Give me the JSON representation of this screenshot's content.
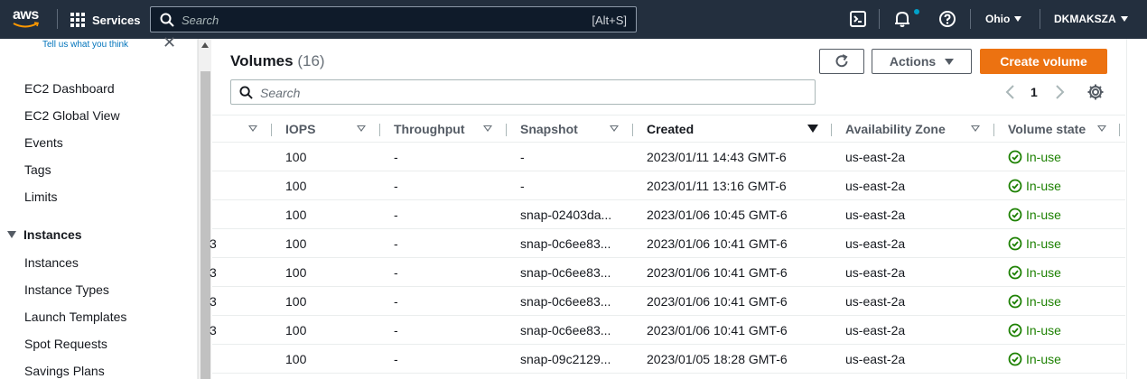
{
  "nav": {
    "logo_text": "aws",
    "services_label": "Services",
    "search_placeholder": "Search",
    "search_shortcut": "[Alt+S]",
    "region": "Ohio",
    "account": "DKMAKSZA"
  },
  "sidebar": {
    "feedback": "Tell us what you think",
    "items_top": [
      "EC2 Dashboard",
      "EC2 Global View",
      "Events",
      "Tags",
      "Limits"
    ],
    "section_instances": "Instances",
    "items_instances": [
      "Instances",
      "Instance Types",
      "Launch Templates",
      "Spot Requests",
      "Savings Plans"
    ]
  },
  "volumes": {
    "title": "Volumes",
    "count": "(16)",
    "actions_label": "Actions",
    "create_label": "Create volume",
    "filter_placeholder": "Search",
    "page": "1"
  },
  "table": {
    "headers": {
      "iops": "IOPS",
      "throughput": "Throughput",
      "snapshot": "Snapshot",
      "created": "Created",
      "az": "Availability Zone",
      "state": "Volume state"
    },
    "rows": [
      {
        "left": "",
        "iops": "100",
        "throughput": "-",
        "snapshot": "-",
        "created": "2023/01/11 14:43 GMT-6",
        "az": "us-east-2a",
        "state": "In-use"
      },
      {
        "left": "",
        "iops": "100",
        "throughput": "-",
        "snapshot": "-",
        "created": "2023/01/11 13:16 GMT-6",
        "az": "us-east-2a",
        "state": "In-use"
      },
      {
        "left": "",
        "iops": "100",
        "throughput": "-",
        "snapshot": "snap-02403da...",
        "created": "2023/01/06 10:45 GMT-6",
        "az": "us-east-2a",
        "state": "In-use"
      },
      {
        "left": "3",
        "iops": "100",
        "throughput": "-",
        "snapshot": "snap-0c6ee83...",
        "created": "2023/01/06 10:41 GMT-6",
        "az": "us-east-2a",
        "state": "In-use"
      },
      {
        "left": "3",
        "iops": "100",
        "throughput": "-",
        "snapshot": "snap-0c6ee83...",
        "created": "2023/01/06 10:41 GMT-6",
        "az": "us-east-2a",
        "state": "In-use"
      },
      {
        "left": "3",
        "iops": "100",
        "throughput": "-",
        "snapshot": "snap-0c6ee83...",
        "created": "2023/01/06 10:41 GMT-6",
        "az": "us-east-2a",
        "state": "In-use"
      },
      {
        "left": "3",
        "iops": "100",
        "throughput": "-",
        "snapshot": "snap-0c6ee83...",
        "created": "2023/01/06 10:41 GMT-6",
        "az": "us-east-2a",
        "state": "In-use"
      },
      {
        "left": "",
        "iops": "100",
        "throughput": "-",
        "snapshot": "snap-09c2129...",
        "created": "2023/01/05 18:28 GMT-6",
        "az": "us-east-2a",
        "state": "In-use"
      }
    ]
  },
  "colors": {
    "nav_bg": "#232f3e",
    "accent_orange": "#ec7211",
    "status_green": "#1d8102",
    "link_blue": "#0073bb"
  },
  "icons": [
    "aws-logo",
    "services-grid-icon",
    "search-icon",
    "cloudshell-icon",
    "bell-icon",
    "help-icon",
    "close-icon",
    "refresh-icon",
    "chevron-left-icon",
    "chevron-right-icon",
    "gear-icon",
    "sort-icon",
    "check-circle-icon"
  ]
}
